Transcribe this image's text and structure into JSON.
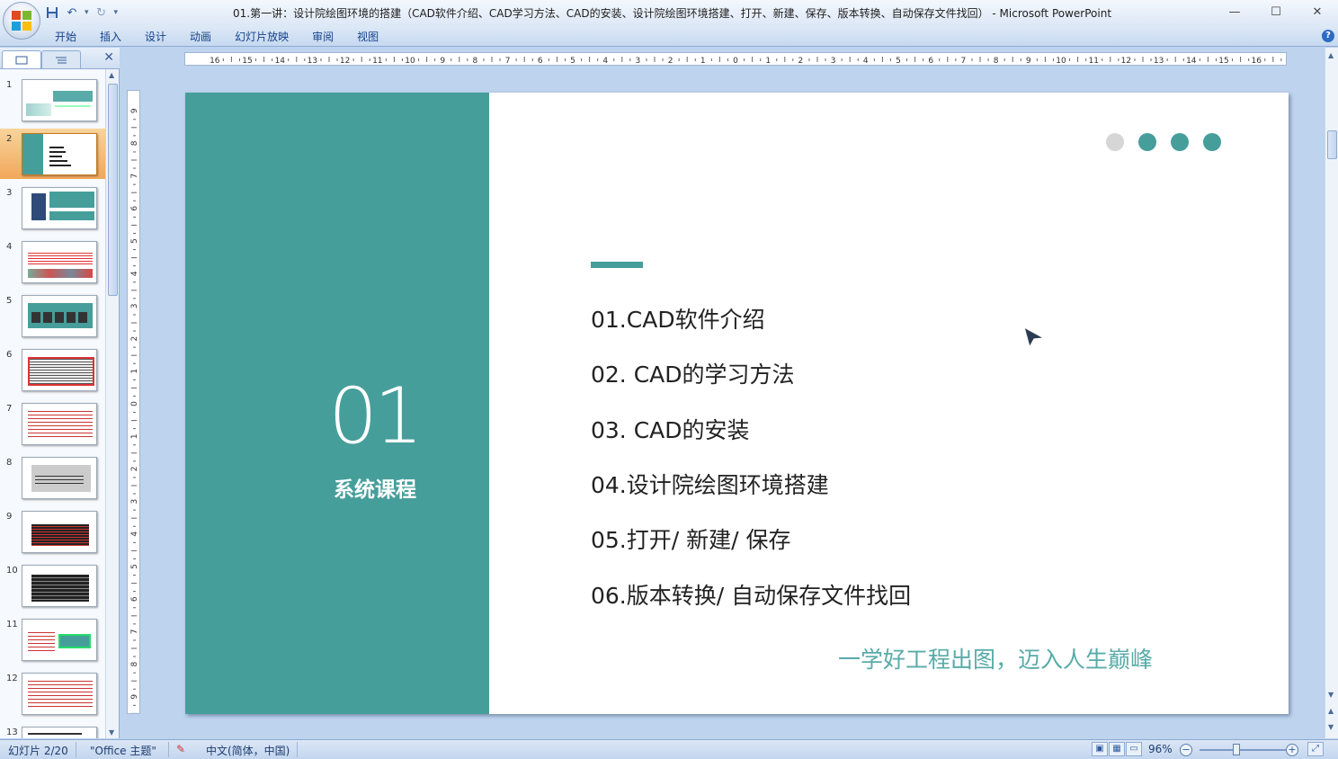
{
  "window": {
    "title": "01.第一讲：设计院绘图环境的搭建（CAD软件介绍、CAD学习方法、CAD的安装、设计院绘图环境搭建、打开、新建、保存、版本转换、自动保存文件找回）  - Microsoft PowerPoint",
    "minimize": "—",
    "maximize": "☐",
    "close": "✕"
  },
  "ribbon": {
    "tabs": [
      "开始",
      "插入",
      "设计",
      "动画",
      "幻灯片放映",
      "审阅",
      "视图"
    ],
    "help": "?"
  },
  "slides_panel": {
    "numbers": [
      "1",
      "2",
      "3",
      "4",
      "5",
      "6",
      "7",
      "8",
      "9",
      "10",
      "11",
      "12",
      "13"
    ],
    "selected": 2
  },
  "slide": {
    "big_number": "01",
    "course_label": "系统课程",
    "items": [
      "01.CAD软件介绍",
      "02. CAD的学习方法",
      "03. CAD的安装",
      "04.设计院绘图环境搭建",
      "05.打开/ 新建/ 保存",
      "06.版本转换/ 自动保存文件找回"
    ],
    "tagline": "一学好工程出图，迈入人生巅峰",
    "colors": {
      "teal": "#469e9b",
      "grey_dot": "#d6d6d6",
      "tagline": "#58aba8"
    }
  },
  "status": {
    "slide_indicator": "幻灯片 2/20",
    "theme": "\"Office 主题\"",
    "language": "中文(简体，中国)",
    "zoom": "96%"
  }
}
